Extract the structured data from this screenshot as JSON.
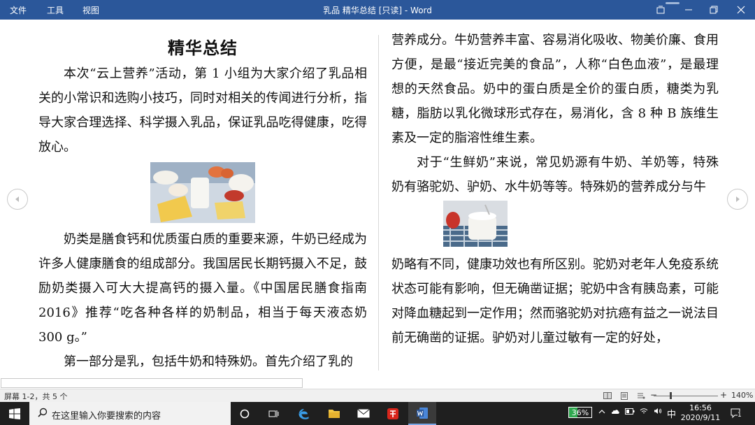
{
  "titlebar": {
    "menu": [
      "文件",
      "工具",
      "视图"
    ],
    "document_title": "乳品 精华总结  [只读] - Word",
    "accent": "#2b579a"
  },
  "document": {
    "left_page": {
      "heading": "精华总结",
      "paragraphs": [
        "本次“云上营养”活动，第 1 小组为大家介绍了乳品相关的小常识和选购小技巧，同时对相关的传闻进行分析，指导大家合理选择、科学摄入乳品，保证乳品吃得健康，吃得放心。",
        "奶类是膳食钙和优质蛋白质的重要来源，牛奶已经成为许多人健康膳食的组成部分。我国居民长期钙摄入不足，鼓励奶类摄入可大大提高钙的摄入量。《中国居民膳食指南 2016》推荐“吃各种各样的奶制品，相当于每天液态奶 300  g。”",
        "第一部分是乳，包括牛奶和特殊奶。首先介绍了乳的"
      ]
    },
    "right_page": {
      "paragraphs": [
        "营养成分。牛奶营养丰富、容易消化吸收、物美价廉、食用方便，是最“接近完美的食品”，人称“白色血液”，是最理想的天然食品。奶中的蛋白质是全价的蛋白质，糖类为乳糖，脂肪以乳化微球形式存在，易消化，含 8 种 B 族维生素及一定的脂溶性维生素。",
        "对于“生鲜奶”来说，常见奶源有牛奶、羊奶等，特殊奶有骆驼奶、驴奶、水牛奶等等。特殊奶的营养成分与牛",
        "奶略有不同，健康功效也有所区别。驼奶对老年人免疫系统状态可能有影响，但无确凿证据；驼奶中含有胰岛素，可能对降血糖起到一定作用；然而骆驼奶对抗癌有益之一说法目前无确凿的证据。驴奶对儿童过敏有一定的好处，"
      ]
    }
  },
  "statusbar": {
    "pages": "屏幕 1-2，共 5 个",
    "zoom_minus": "−",
    "zoom_plus": "+",
    "zoom": "140%"
  },
  "taskbar": {
    "search_placeholder": "在这里输入你要搜索的内容",
    "battery_percent": "36%",
    "battery_level": 0.36,
    "ime": "中",
    "time": "16:56",
    "date": "2020/9/11",
    "notification_count": "1",
    "colors": {
      "bar": "#1f1f1f",
      "battery": "#2fa84f"
    }
  }
}
